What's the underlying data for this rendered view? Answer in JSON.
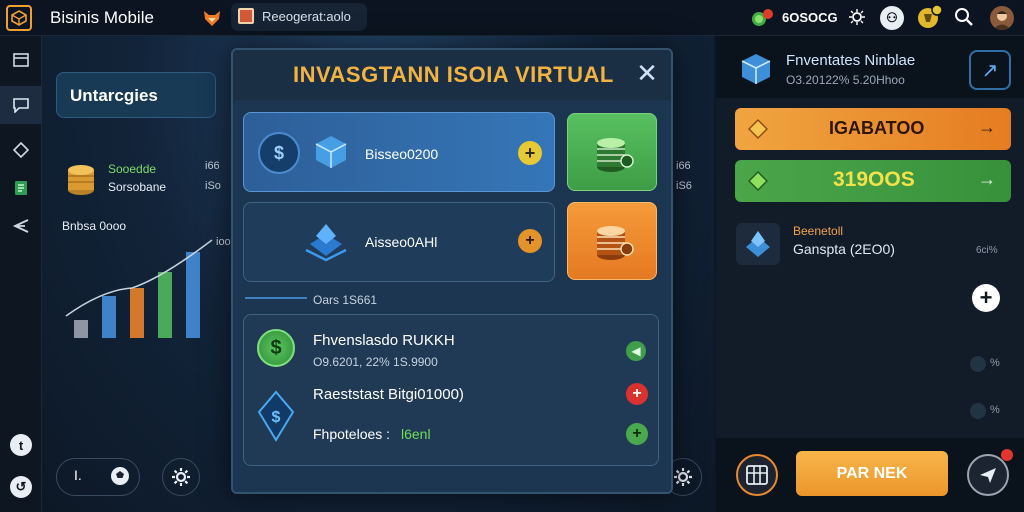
{
  "app": {
    "title": "Bisinis Mobile"
  },
  "topbar": {
    "search_text": "Reeogerat:aolo",
    "coin_value": "6OSOCG"
  },
  "dashboard": {
    "card_label": "Untarcgies",
    "stat_line1": "Sooedde",
    "stat_line2": "Sorsobane",
    "stat_line3": "Bnbsa 0ooo",
    "pct_a": "i66",
    "pct_b": "iSo",
    "pct_c": "ioo",
    "pct_d": "i66",
    "pct_e": "iS6",
    "bottom_btn1_label": "I."
  },
  "modal": {
    "title": "INVASGTANN ISOIA VIRTUAL",
    "close_symbol": "✕",
    "row1_text": "Bisseo0200",
    "row1_action": "+",
    "row2_text": "Aisseo0AHl",
    "row2_action": "+",
    "section_label": "Oars 1S661",
    "list": [
      {
        "title": "Fhvenslasdo RUKKH",
        "sub": "O9.6201, 22% 1S.9900",
        "action": "◀"
      },
      {
        "title": "Raeststast Bitgi01000)",
        "action": "+"
      },
      {
        "label": "Fhpoteloes :",
        "value": "l6enl",
        "action": "+"
      }
    ]
  },
  "right_panel": {
    "title": "Fnventates Ninblae",
    "subtitle": "O3.20122% 5.20Hhoo",
    "btn1_label": "IGABATOO",
    "btn2_label": "319OOS",
    "arrow_symbol": "→",
    "item_title": "Beenetoll",
    "item_sub": "Ganspta (2EO0)",
    "item_pct": "6ci%",
    "pct_1": "%",
    "pct_2": "%",
    "cta_label": "PAR NEK"
  },
  "colors": {
    "accent_orange": "#f0a540",
    "accent_green": "#4ba64a",
    "panel_blue": "#2d5f98",
    "title_gold": "#f3b340"
  }
}
